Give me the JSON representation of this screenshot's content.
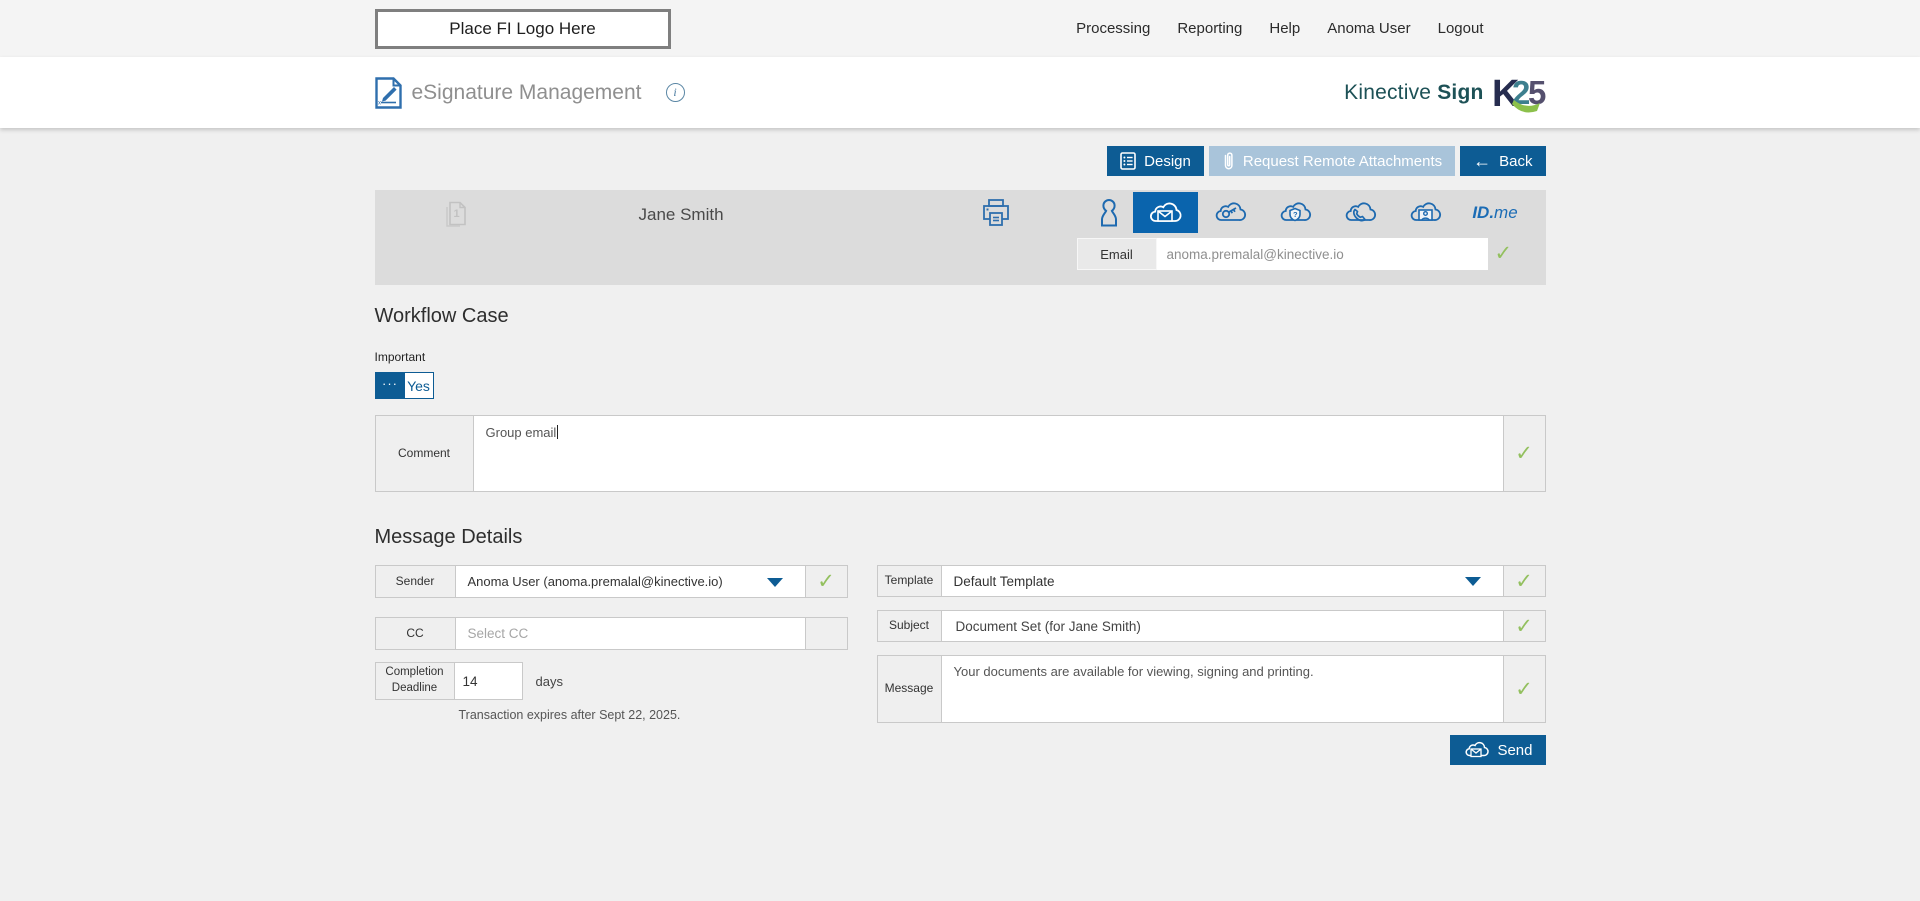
{
  "topbar": {
    "logo_placeholder": "Place FI Logo Here",
    "nav": [
      "Processing",
      "Reporting",
      "Help",
      "Anoma User",
      "Logout"
    ]
  },
  "header": {
    "title": "eSignature Management",
    "info_glyph": "i",
    "brand_name": "Kinective",
    "brand_product": "Sign"
  },
  "toolbar": {
    "design": "Design",
    "request_remote_attachments": "Request Remote Attachments",
    "back": "Back",
    "back_arrow": "←"
  },
  "recipient": {
    "name": "Jane Smith",
    "document_badge": "1",
    "email_label": "Email",
    "email_value": "anoma.premalal@kinective.io",
    "idme_prefix": "ID.",
    "idme_suffix": "me",
    "valid_check": "✓"
  },
  "workflow_case": {
    "heading": "Workflow Case",
    "important_label": "Important",
    "toggle_dots": "···",
    "toggle_value": "Yes",
    "comment_label": "Comment",
    "comment_value": "Group email",
    "valid_check": "✓"
  },
  "message_details": {
    "heading": "Message Details",
    "sender": {
      "label": "Sender",
      "value": "Anoma User (anoma.premalal@kinective.io)"
    },
    "cc": {
      "label": "CC",
      "placeholder": "Select CC"
    },
    "completion_deadline": {
      "label": "Completion Deadline",
      "value": "14",
      "unit": "days",
      "note": "Transaction expires after Sept 22, 2025."
    },
    "template": {
      "label": "Template",
      "value": "Default Template"
    },
    "subject": {
      "label": "Subject",
      "value": "Document Set (for Jane Smith)"
    },
    "message": {
      "label": "Message",
      "value": "Your documents are available for viewing, signing and printing."
    },
    "send": "Send",
    "valid_check": "✓"
  },
  "colors": {
    "accent_blue": "#0d5c94",
    "selected_tile_blue": "#0a64ad",
    "icon_blue": "#2f6fad",
    "disabled_blue": "#a9c4da",
    "check_green": "#93c05f",
    "brand_teal": "#1d5156",
    "idme_blue": "#1b6cb5",
    "panel_gray": "#dcdcdc",
    "page_gray": "#f0f0f0"
  }
}
